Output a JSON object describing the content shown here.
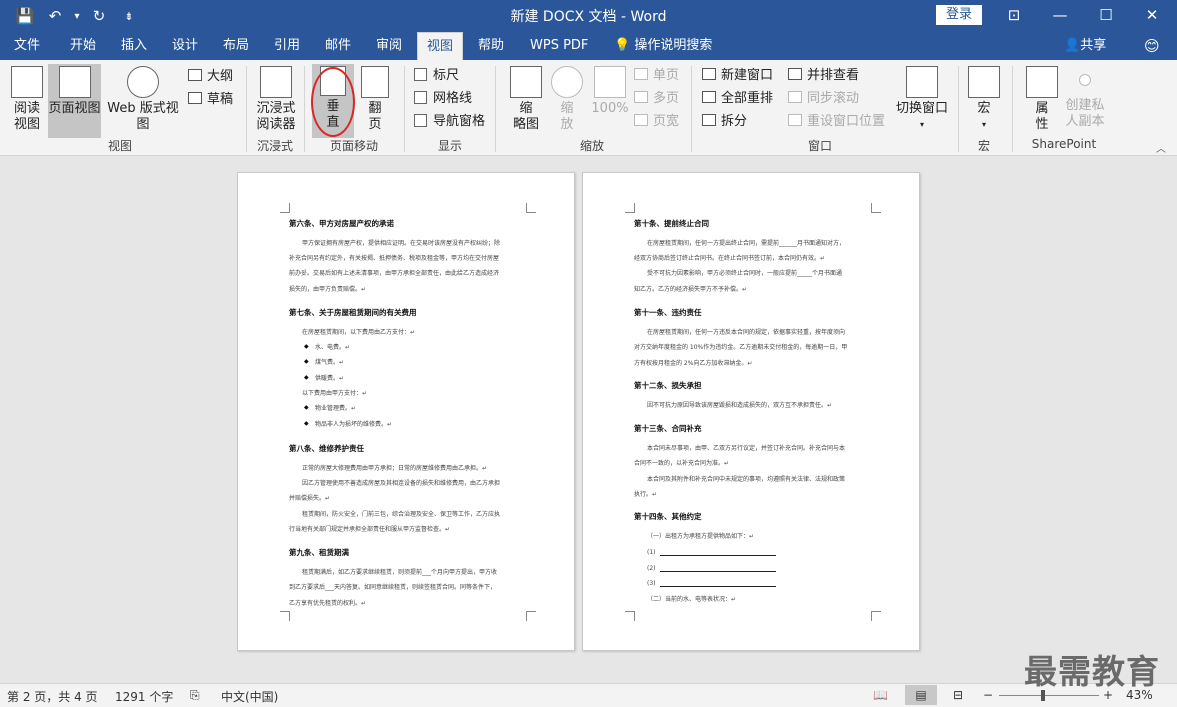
{
  "titlebar": {
    "title": "新建 DOCX 文档 - Word",
    "login": "登录",
    "qat": {
      "save_icon": "💾",
      "undo_icon": "↶",
      "undo_arrow": "▾",
      "redo_icon": "↻",
      "customize_icon": "⇟"
    },
    "win": {
      "ribbon_display": "⊡",
      "minimize": "—",
      "maximize": "☐",
      "close": "✕"
    }
  },
  "tabs": [
    "文件",
    "开始",
    "插入",
    "设计",
    "布局",
    "引用",
    "邮件",
    "审阅",
    "视图",
    "帮助",
    "WPS PDF"
  ],
  "tell_me": "操作说明搜索",
  "share": "共享",
  "ribbon": {
    "views": {
      "group": "视图",
      "read": "阅读\n视图",
      "print": "页面视图",
      "web": "Web 版式视图",
      "outline": "大纲",
      "draft": "草稿"
    },
    "immersive": {
      "group": "沉浸式",
      "reader": "沉浸式\n阅读器"
    },
    "page_move": {
      "group": "页面移动",
      "vertical": "垂\n直",
      "side": "翻\n页"
    },
    "show": {
      "group": "显示",
      "ruler": "标尺",
      "gridlines": "网格线",
      "nav": "导航窗格"
    },
    "zoom": {
      "group": "缩放",
      "thumb": "缩\n略图",
      "zoom": "缩\n放",
      "hundred": "100%",
      "one": "单页",
      "multi": "多页",
      "width": "页宽"
    },
    "window": {
      "group": "窗口",
      "new": "新建窗口",
      "arrange": "全部重排",
      "split": "拆分",
      "side": "并排查看",
      "sync": "同步滚动",
      "reset": "重设窗口位置",
      "switch": "切换窗口"
    },
    "macros": {
      "group": "宏",
      "macro": "宏"
    },
    "sharepoint": {
      "group": "SharePoint",
      "props": "属\n性",
      "copy": "创建私\n人副本"
    }
  },
  "page1": {
    "h6": "第六条、甲方对房屋产权的承诺",
    "p6a": "甲方保证拥有房屋产权，提供相应证明。在交易时该房屋没有产权纠纷；除",
    "p6b": "补充合同另有约定外，有关按揭、抵押债务、税项及租金等，甲方均在交付房屋",
    "p6c": "前办妥。交易后如有上述未清事项，由甲方承担全部责任，由此给乙方造成经济",
    "p6d": "损失的，由甲方负责赔偿。↵",
    "h7": "第七条、关于房屋租赁期间的有关费用",
    "p7a": "在房屋租赁期间，以下费用由乙方支付：↵",
    "b1": "水、电费。↵",
    "b2": "煤气费。↵",
    "b3": "供暖费。↵",
    "p7b": "以下费用由甲方支付：↵",
    "b4": "物业管理费。↵",
    "b5": "物品非人为损坏的维修费。↵",
    "h8": "第八条、维修养护责任",
    "p8a": "正常的房屋大修理费用由甲方承担；日常的房屋维修费用由乙承担。↵",
    "p8b": "因乙方管理使用不善造成房屋及其相连设备的损失和维修费用，由乙方承担",
    "p8c": "并赔偿损失。↵",
    "p8d": "租赁期间，防火安全，门前三包，综合治理及安全、保卫等工作，乙方应执",
    "p8e": "行当地有关部门规定并承担全部责任和服从甲方监督检查。↵",
    "h9": "第九条、租赁期满",
    "p9a": "租赁期满后，如乙方要求继续租赁，则须提前___个月向甲方提出，甲方收",
    "p9b": "到乙方要求后___天内答复。如同意继续租赁，则续签租赁合同。同等条件下，",
    "p9c": "乙方享有优先租赁的权利。↵"
  },
  "page2": {
    "h10": "第十条、提前终止合同",
    "p10a": "在房屋租赁期间，任何一方提出终止合同，需提前______月书面通知对方，",
    "p10b": "经双方协商后签订终止合同书。在终止合同书签订前，本合同仍有效。↵",
    "p10c": "受不可抗力因素影响，甲方必须终止合同时，一般应提前_____个月书面通",
    "p10d": "知乙方。乙方的经济损失甲方不予补偿。↵",
    "h11": "第十一条、违约责任",
    "p11a": "在房屋租赁期间，任何一方违反本合同的规定，依据事实轻重，按年度须向",
    "p11b": "对方交纳年度租金的 10%作为违约金。乙方逾期未交付租金的，每逾期一日，甲",
    "p11c": "方有权按月租金的 2%向乙方加收滞纳金。↵",
    "h12": "第十二条、损失承担",
    "p12a": "因不可抗力原因导致该房屋毁损和造成损失的，双方互不承担责任。↵",
    "h13": "第十三条、合同补充",
    "p13a": "本合同未尽事项，由甲、乙双方另行议定，并签订补充合同。补充合同与本",
    "p13b": "合同不一致的，以补充合同为准。↵",
    "p13c": "本合同及其附件和补充合同中未规定的事项，均遵照有关法律、法规和政策",
    "p13d": "执行。↵",
    "h14": "第十四条、其他约定",
    "p14a": "（一）出租方为承租方提供物品如下：↵",
    "l1": "(1)",
    "l2": "(2)",
    "l3": "(3)",
    "p14b": "（二）当前的水、电等表状况：↵"
  },
  "status": {
    "page": "第 2 页，共 4 页",
    "words": "1291 个字",
    "lang": "中文(中国)",
    "zoom": "43%",
    "minus": "−",
    "plus": "+"
  },
  "watermark": "最需教育"
}
